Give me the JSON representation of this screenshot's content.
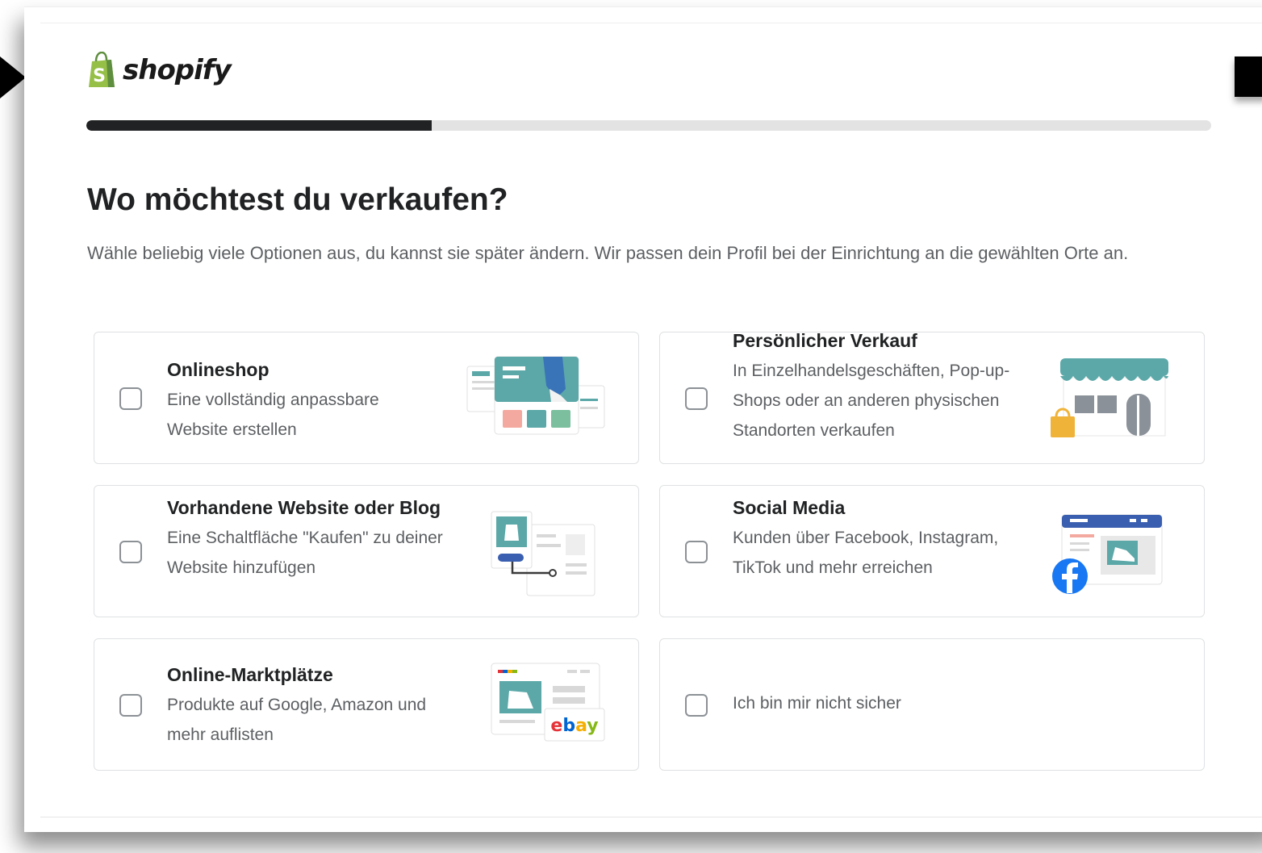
{
  "brand": {
    "logo_text": "shopify",
    "bag_letter": "S",
    "brand_green": "#95bf47"
  },
  "progress": {
    "fraction": 0.307
  },
  "header": {
    "title": "Wo möchtest du verkaufen?",
    "subtitle": "Wähle beliebig viele Optionen aus, du kannst sie später ändern. Wir passen dein Profil bei der Einrichtung an die gewählten Orte an."
  },
  "options": [
    {
      "title": "Onlineshop",
      "description": "Eine vollständig anpassbare Website erstellen",
      "icon": "online-store-illustration",
      "checked": false
    },
    {
      "title": "Persönlicher Verkauf",
      "description": "In Einzelhandelsgeschäften, Pop-up-Shops oder an anderen physischen Standorten verkaufen",
      "icon": "retail-store-illustration",
      "checked": false
    },
    {
      "title": "Vorhandene Website oder Blog",
      "description": "Eine Schaltfläche \"Kaufen\" zu deiner Website hinzufügen",
      "icon": "buy-button-illustration",
      "checked": false
    },
    {
      "title": "Social Media",
      "description": "Kunden über Facebook, Instagram, TikTok und mehr erreichen",
      "icon": "social-media-illustration",
      "checked": false
    },
    {
      "title": "Online-Marktplätze",
      "description": "Produkte auf Google, Amazon und mehr auflisten",
      "icon": "marketplace-illustration",
      "checked": false,
      "badge": "ebay"
    },
    {
      "label": "Ich bin mir nicht sicher",
      "checked": false
    }
  ],
  "colors": {
    "text_primary": "#202223",
    "text_secondary": "#5c5f62",
    "border": "#dfe1e3",
    "progress_track": "#e3e3e3",
    "progress_fill": "#202223",
    "teal": "#5ca8a8",
    "facebook_blue": "#1877f2"
  }
}
